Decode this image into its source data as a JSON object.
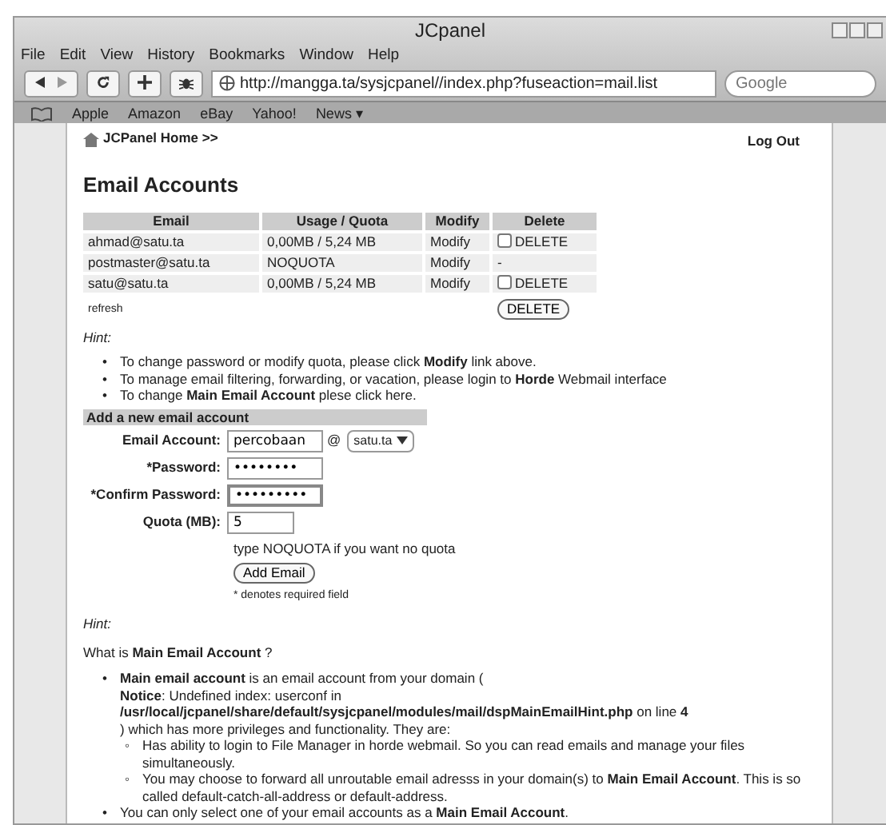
{
  "window": {
    "title": "JCpanel"
  },
  "menu": [
    "File",
    "Edit",
    "View",
    "History",
    "Bookmarks",
    "Window",
    "Help"
  ],
  "address": "http://mangga.ta/sysjcpanel//index.php?fuseaction=mail.list",
  "search": {
    "placeholder": "Google"
  },
  "bookmarks": [
    "Apple",
    "Amazon",
    "eBay",
    "Yahoo!",
    "News ▾"
  ],
  "page": {
    "home_link": "JCPanel Home >>",
    "logout": "Log Out",
    "heading": "Email Accounts",
    "table": {
      "columns": [
        "Email",
        "Usage / Quota",
        "Modify",
        "Delete"
      ],
      "rows": [
        {
          "email": "ahmad@satu.ta",
          "usage": "0,00MB / 5,24 MB",
          "modify": "Modify",
          "delete": {
            "kind": "checkbox",
            "label": "DELETE",
            "checked": false
          }
        },
        {
          "email": "postmaster@satu.ta",
          "usage": "NOQUOTA",
          "modify": "Modify",
          "delete": {
            "kind": "dash",
            "label": "-"
          }
        },
        {
          "email": "satu@satu.ta",
          "usage": "0,00MB / 5,24 MB",
          "modify": "Modify",
          "delete": {
            "kind": "checkbox",
            "label": "DELETE",
            "checked": false
          }
        }
      ],
      "refresh": "refresh",
      "delete_button": "DELETE"
    },
    "hint1": {
      "title": "Hint:",
      "marker": "•",
      "items": [
        "To change password or modify quota, please click **Modify** link above.",
        "To manage email filtering, forwarding, or vacation, please login to **Horde** Webmail interface",
        "To change **Main Email Account** plese click here."
      ]
    },
    "form": {
      "title": "Add a new email account",
      "fields": [
        {
          "label": "Email Account:",
          "value": "percobaan",
          "at": "@",
          "domain": "satu.ta",
          "focused": false
        },
        {
          "label": "*Password:",
          "value": "••••••••",
          "focused": false
        },
        {
          "label": "*Confirm Password:",
          "value": "•••••••••",
          "focused": true
        },
        {
          "label": "Quota (MB):",
          "value": "5",
          "focused": false
        }
      ],
      "quota_note": "type NOQUOTA if you want no quota",
      "button": "Add Email",
      "required_note": "* denotes required field"
    },
    "hint2": {
      "title": "Hint:",
      "marker": "•",
      "sub_marker": "◦",
      "question": "What is **Main Email Account** ?",
      "items": [
        {
          "lines": [
            "**Main email account** is an email account from your domain (",
            "**Notice**: Undefined index: userconf in",
            "**/usr/local/jcpanel/share/default/sysjcpanel/modules/mail/dspMainEmailHint.php** on line **4**",
            ") which has more privileges and functionality. They are:"
          ],
          "children": [
            "Has ability to login to File Manager in horde webmail. So you can read emails and manage your files simultaneously.",
            "You may choose to forward all unroutable email adresss in your domain(s) to **Main Email Account**. This is so called default-catch-all-address or default-address."
          ]
        },
        {
          "lines": [
            "You can only select one of your email accounts as a **Main Email Account**."
          ]
        }
      ]
    }
  }
}
